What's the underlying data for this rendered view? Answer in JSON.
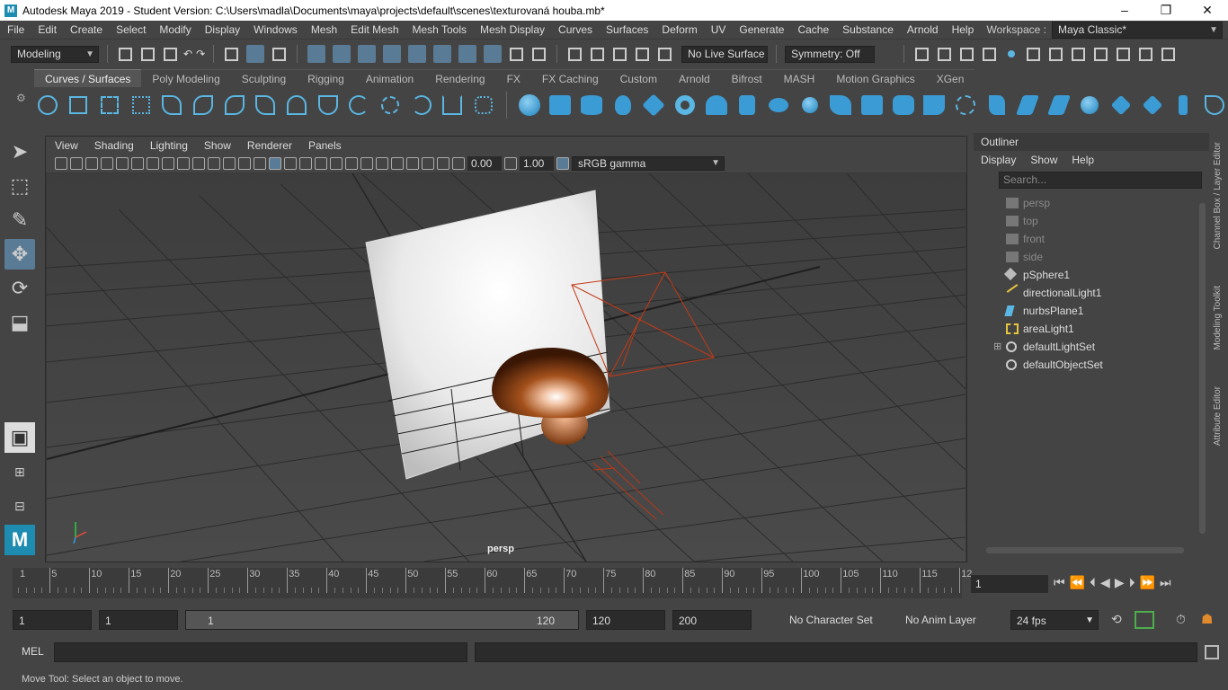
{
  "window": {
    "title": "Autodesk Maya 2019 - Student Version: C:\\Users\\madla\\Documents\\maya\\projects\\default\\scenes\\texturovaná houba.mb*",
    "logo_letter": "M",
    "minimize": "–",
    "restore": "❐",
    "close": "✕"
  },
  "menubar": {
    "items": [
      "File",
      "Edit",
      "Create",
      "Select",
      "Modify",
      "Display",
      "Windows",
      "Mesh",
      "Edit Mesh",
      "Mesh Tools",
      "Mesh Display",
      "Curves",
      "Surfaces",
      "Deform",
      "UV",
      "Generate",
      "Cache",
      "Substance",
      "Arnold",
      "Help"
    ],
    "workspace_label": "Workspace :",
    "workspace_value": "Maya Classic*"
  },
  "statusline": {
    "menuset": "Modeling",
    "live_surface": "No Live Surface",
    "symmetry": "Symmetry: Off"
  },
  "shelf": {
    "tabs": [
      "Curves / Surfaces",
      "Poly Modeling",
      "Sculpting",
      "Rigging",
      "Animation",
      "Rendering",
      "FX",
      "FX Caching",
      "Custom",
      "Arnold",
      "Bifrost",
      "MASH",
      "Motion Graphics",
      "XGen"
    ],
    "active_tab": 0
  },
  "viewport": {
    "menus": [
      "View",
      "Shading",
      "Lighting",
      "Show",
      "Renderer",
      "Panels"
    ],
    "exposure": "0.00",
    "gamma": "1.00",
    "color_space": "sRGB gamma",
    "camera_label": "persp"
  },
  "outliner": {
    "title": "Outliner",
    "menus": [
      "Display",
      "Show",
      "Help"
    ],
    "search_placeholder": "Search...",
    "items": [
      {
        "label": "persp",
        "icon": "camera-icon",
        "dim": true
      },
      {
        "label": "top",
        "icon": "camera-icon",
        "dim": true
      },
      {
        "label": "front",
        "icon": "camera-icon",
        "dim": true
      },
      {
        "label": "side",
        "icon": "camera-icon",
        "dim": true
      },
      {
        "label": "pSphere1",
        "icon": "mesh-icon",
        "dim": false
      },
      {
        "label": "directionalLight1",
        "icon": "directional-light-icon",
        "dim": false
      },
      {
        "label": "nurbsPlane1",
        "icon": "nurbs-plane-icon",
        "dim": false
      },
      {
        "label": "areaLight1",
        "icon": "area-light-icon",
        "dim": false
      },
      {
        "label": "defaultLightSet",
        "icon": "set-icon",
        "dim": false,
        "expandable": true
      },
      {
        "label": "defaultObjectSet",
        "icon": "set-icon",
        "dim": false
      }
    ]
  },
  "side_tabs": [
    "Channel Box / Layer Editor",
    "Modeling Toolkit",
    "Attribute Editor"
  ],
  "timeline": {
    "labels": [
      "1",
      "5",
      "10",
      "15",
      "20",
      "25",
      "30",
      "35",
      "40",
      "45",
      "50",
      "55",
      "60",
      "65",
      "70",
      "75",
      "80",
      "85",
      "90",
      "95",
      "100",
      "105",
      "110",
      "115",
      "12"
    ],
    "current_frame": "1"
  },
  "range": {
    "start": "1",
    "playback_start": "1",
    "slider_start": "1",
    "slider_end": "120",
    "playback_end": "120",
    "end": "200",
    "character_set": "No Character Set",
    "anim_layer": "No Anim Layer",
    "fps": "24 fps"
  },
  "command": {
    "lang": "MEL"
  },
  "help_line": "Move Tool: Select an object to move."
}
